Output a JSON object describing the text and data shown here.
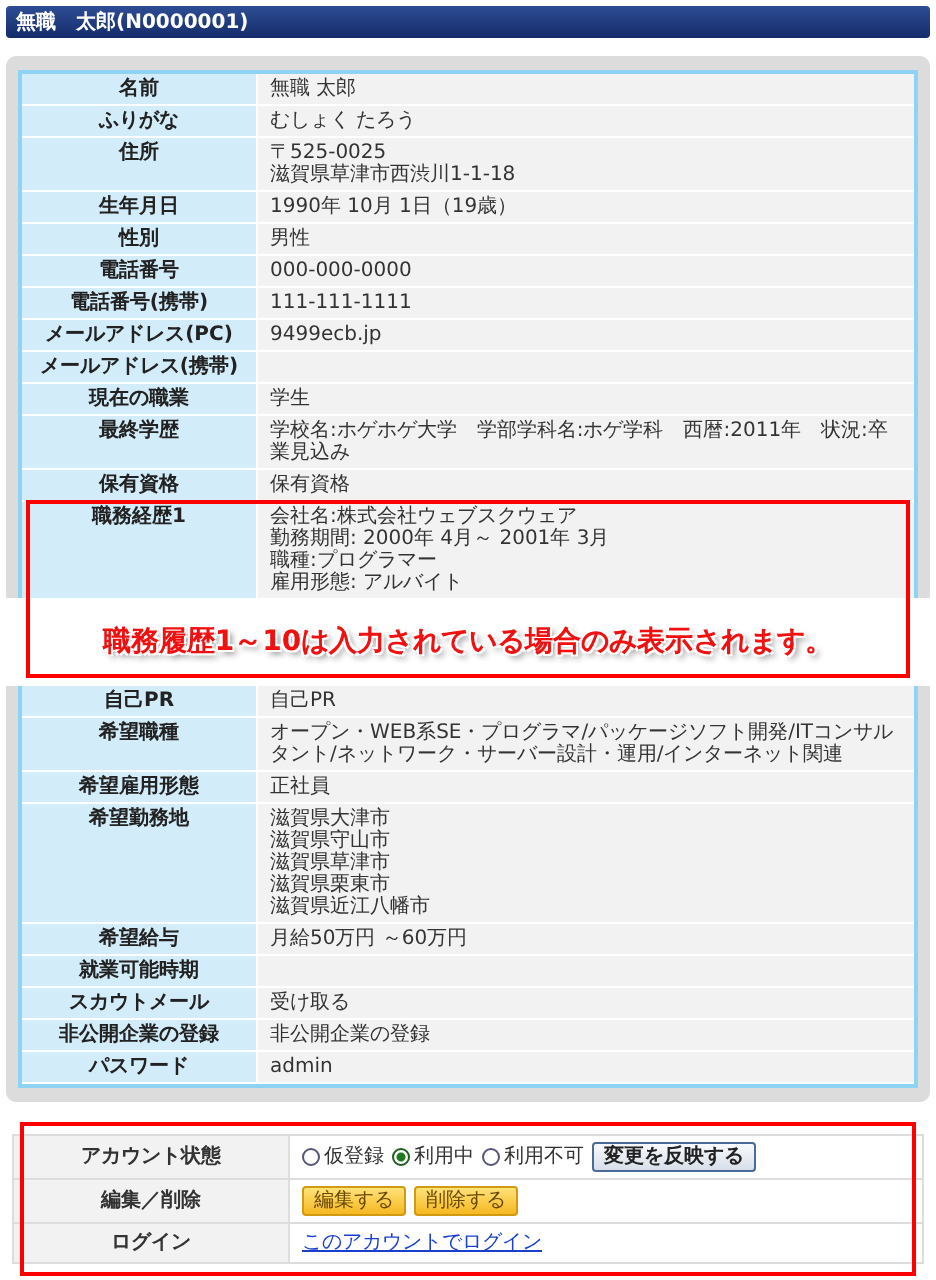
{
  "header": {
    "title": "無職　太郎(N0000001)"
  },
  "profile_rows": [
    {
      "label": "名前",
      "lines": [
        "無職 太郎"
      ]
    },
    {
      "label": "ふりがな",
      "lines": [
        "むしょく たろう"
      ]
    },
    {
      "label": "住所",
      "lines": [
        "〒525-0025",
        "滋賀県草津市西渋川1-1-18"
      ]
    },
    {
      "label": "生年月日",
      "lines": [
        "1990年 10月 1日（19歳）"
      ]
    },
    {
      "label": "性別",
      "lines": [
        "男性"
      ]
    },
    {
      "label": "電話番号",
      "lines": [
        "000-000-0000"
      ]
    },
    {
      "label": "電話番号(携帯)",
      "lines": [
        "111-111-1111"
      ]
    },
    {
      "label": "メールアドレス(PC)",
      "lines": [
        "9499ecb.jp"
      ]
    },
    {
      "label": "メールアドレス(携帯)"
    },
    {
      "label": "現在の職業",
      "lines": [
        "学生"
      ]
    },
    {
      "label": "最終学歴",
      "lines": [
        "学校名:ホゲホゲ大学　学部学科名:ホゲ学科　西暦:2011年　状況:卒業見込み"
      ]
    },
    {
      "label": "保有資格",
      "lines": [
        "保有資格"
      ]
    }
  ],
  "work_history": [
    {
      "label": "職務経歴1",
      "lines": [
        "会社名:株式会社ウェブスクウェア",
        "勤務期間: 2000年 4月～ 2001年 3月",
        "職種:プログラマー",
        "雇用形態: アルバイト"
      ]
    }
  ],
  "annotation": {
    "text": "職務履歴1～10は入力されている場合のみ表示されます。"
  },
  "profile_rows_2": [
    {
      "label": "自己PR",
      "lines": [
        "自己PR"
      ]
    },
    {
      "label": "希望職種",
      "lines": [
        "オープン・WEB系SE・プログラマ/パッケージソフト開発/ITコンサルタント/ネットワーク・サーバー設計・運用/インターネット関連"
      ]
    },
    {
      "label": "希望雇用形態",
      "lines": [
        "正社員"
      ]
    },
    {
      "label": "希望勤務地",
      "lines": [
        "滋賀県大津市",
        "滋賀県守山市",
        "滋賀県草津市",
        "滋賀県栗東市",
        "滋賀県近江八幡市"
      ]
    },
    {
      "label": "希望給与",
      "lines": [
        "月給50万円 ～60万円"
      ]
    },
    {
      "label": "就業可能時期"
    },
    {
      "label": "スカウトメール",
      "lines": [
        "受け取る"
      ]
    },
    {
      "label": "非公開企業の登録",
      "lines": [
        "非公開企業の登録"
      ]
    },
    {
      "label": "パスワード",
      "lines": [
        "admin"
      ]
    }
  ],
  "account": {
    "status": {
      "label": "アカウント状態",
      "options": [
        {
          "label": "仮登録",
          "selected": false
        },
        {
          "label": "利用中",
          "selected": true
        },
        {
          "label": "利用不可",
          "selected": false
        }
      ],
      "apply_button": "変更を反映する"
    },
    "edit": {
      "label": "編集／削除",
      "buttons": [
        "編集する",
        "削除する"
      ]
    },
    "login": {
      "label": "ログイン",
      "link": "このアカウントでログイン"
    }
  }
}
